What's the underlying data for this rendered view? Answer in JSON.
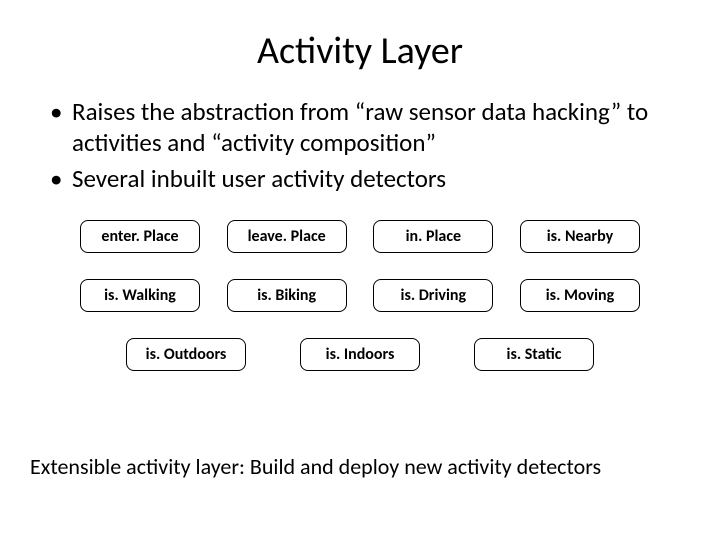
{
  "title": "Activity Layer",
  "bullets": [
    "Raises the abstraction from “raw sensor data hacking” to activities and “activity composition”",
    "Several inbuilt user activity detectors"
  ],
  "rows": {
    "row1": [
      "enter. Place",
      "leave. Place",
      "in. Place",
      "is. Nearby"
    ],
    "row2": [
      "is. Walking",
      "is. Biking",
      "is. Driving",
      "is. Moving"
    ],
    "row3": [
      "is. Outdoors",
      "is. Indoors",
      "is. Static"
    ]
  },
  "footer": "Extensible activity layer: Build and deploy new activity detectors"
}
